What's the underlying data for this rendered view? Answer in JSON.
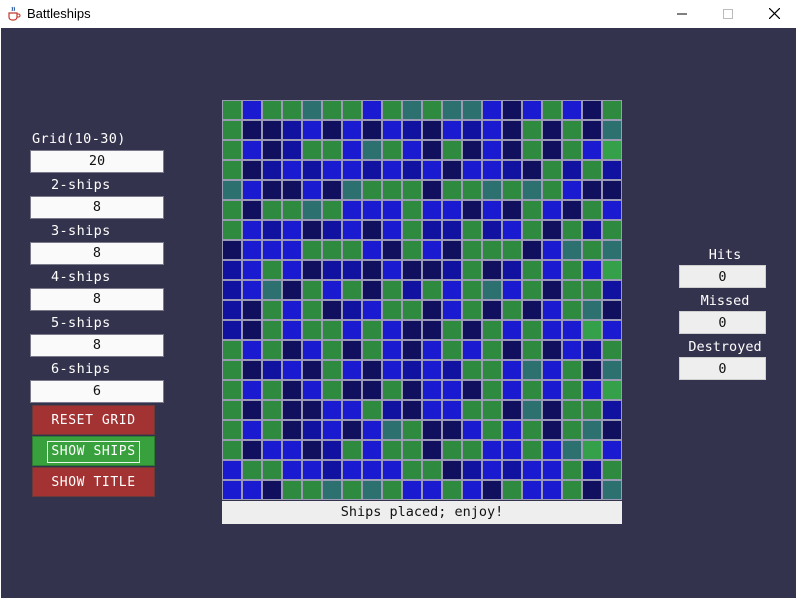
{
  "window": {
    "title": "Battleships",
    "icon": "java-cup-icon",
    "controls": [
      "minimize-icon",
      "maximize-icon",
      "close-icon"
    ]
  },
  "settings": {
    "grid_label": "Grid(10-30)",
    "grid_value": "20",
    "ships": [
      {
        "label": "2-ships",
        "value": "8"
      },
      {
        "label": "3-ships",
        "value": "8"
      },
      {
        "label": "4-ships",
        "value": "8"
      },
      {
        "label": "5-ships",
        "value": "8"
      },
      {
        "label": "6-ships",
        "value": "6"
      }
    ]
  },
  "buttons": {
    "reset": "RESET GRID",
    "show_ships": "SHOW SHIPS",
    "show_title": "SHOW TITLE"
  },
  "status": "Ships placed; enjoy!",
  "stats": {
    "hits_label": "Hits",
    "hits_value": "0",
    "missed_label": "Missed",
    "missed_value": "0",
    "destroyed_label": "Destroyed",
    "destroyed_value": "0"
  },
  "colors": {
    "background": "#33334d",
    "reset_button": "#a33232",
    "show_ships_button": "#38a13d",
    "show_title_button": "#a33232"
  },
  "grid": {
    "size": 20,
    "palette": {
      "W": "#1212a0",
      "N": "#10105e",
      "B": "#1a1ad0",
      "G": "#2e8a3e",
      "T": "#2d7070",
      "L": "#35a04a"
    },
    "rows": [
      "GBGGTGGBGTGTTBNBGBN",
      "GNNWBNBNBWNBWBNGNG",
      "GBNWGGBTGBNGNBNGNG",
      "GNWBWBBWBWBNBBWNG",
      "TBNNBNTGGGNGGTGTGBN",
      "GNGGTGBBBGBBNBNGBNG",
      "GBWBNWBNBGWWGWBGNG",
      "NBBBGGGBNGBNGGGNBTG",
      "WBGBNWWNBNNWGNWGBG",
      "WBTNGBGNGWGBGTBGNG",
      "WNGBGNWBGGNBGNGNBG",
      "WNGBGGBGBNNGNGBGBB",
      "GBGNBGNGBNBGBGNGNB",
      "GNWBNGBNBWBWGGBTBG",
      "GBGNBGNNGNBBNGBGBG",
      "GNGNNBBGWNBBGGNTNG",
      "GBGNWBNBTGNNBGBGNG",
      "GNBBNWGBGGNGGBBGBT",
      "BGGBBWBBBGGNWBWBBG",
      "BBNGGTGTGBBGBNGBBG"
    ]
  }
}
